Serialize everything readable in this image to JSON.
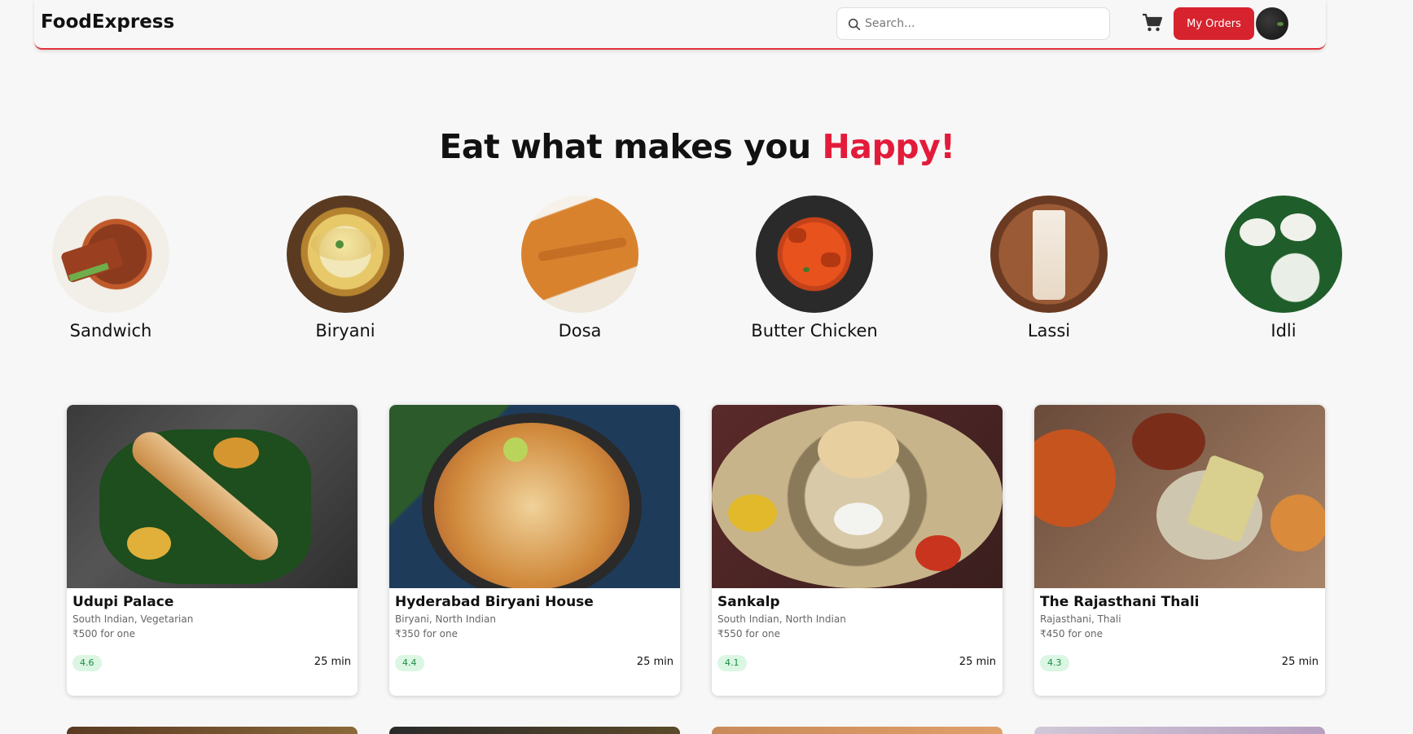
{
  "navbar": {
    "brand": "FoodExpress",
    "search_placeholder": "Search...",
    "orders_label": "My Orders"
  },
  "hero": {
    "text": "Eat what makes you ",
    "accent": "Happy!"
  },
  "categories": [
    {
      "label": "Sandwich"
    },
    {
      "label": "Biryani"
    },
    {
      "label": "Dosa"
    },
    {
      "label": "Butter Chicken"
    },
    {
      "label": "Lassi"
    },
    {
      "label": "Idli"
    }
  ],
  "restaurants": [
    {
      "name": "Udupi Palace",
      "cuisine": "South Indian, Vegetarian",
      "price": "₹500 for one",
      "rating": "4.6",
      "eta": "25 min"
    },
    {
      "name": "Hyderabad Biryani House",
      "cuisine": "Biryani, North Indian",
      "price": "₹350 for one",
      "rating": "4.4",
      "eta": "25 min"
    },
    {
      "name": "Sankalp",
      "cuisine": "South Indian, North Indian",
      "price": "₹550 for one",
      "rating": "4.1",
      "eta": "25 min"
    },
    {
      "name": "The Rajasthani Thali",
      "cuisine": "Rajasthani, Thali",
      "price": "₹450 for one",
      "rating": "4.3",
      "eta": "25 min"
    }
  ],
  "colors": {
    "accent": "#e31b3b",
    "button": "#d7232e",
    "rating_bg": "#dbf6e3",
    "rating_text": "#1c8a43"
  },
  "icons": [
    "search-icon",
    "cart-icon"
  ]
}
